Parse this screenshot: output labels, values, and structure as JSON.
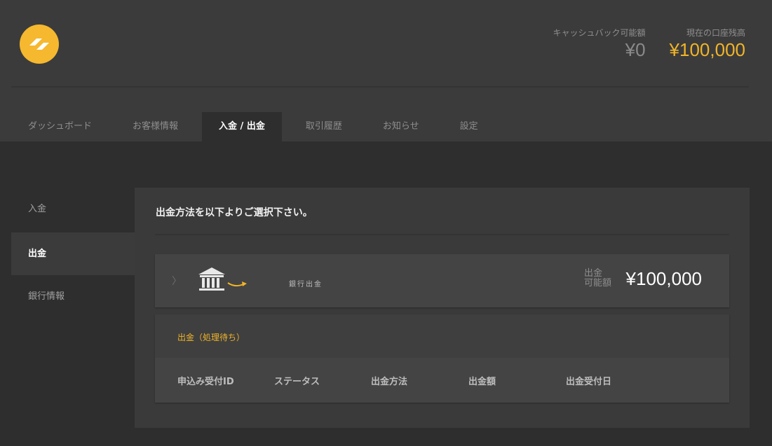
{
  "header": {
    "logo": "logo-icon",
    "cashback": {
      "label": "キャッシュバック可能額",
      "value": "¥0"
    },
    "balance": {
      "label": "現在の口座残高",
      "value": "¥100,000"
    }
  },
  "tabs": [
    {
      "label": "ダッシュボード"
    },
    {
      "label": "お客様情報"
    },
    {
      "label": "入金 / 出金"
    },
    {
      "label": "取引履歴"
    },
    {
      "label": "お知らせ"
    },
    {
      "label": "設定"
    }
  ],
  "sidebar": {
    "items": [
      {
        "label": "入金"
      },
      {
        "label": "出金"
      },
      {
        "label": "銀行情報"
      }
    ]
  },
  "panel": {
    "title": "出金方法を以下よりご選択下さい。",
    "method": {
      "label": "銀行出金",
      "icon": "bank-icon",
      "available_label_line1": "出金",
      "available_label_line2": "可能額",
      "available_value": "¥100,000"
    },
    "pending": {
      "title": "出金（処理待ち）",
      "columns": [
        "申込み受付ID",
        "ステータス",
        "出金方法",
        "出金額",
        "出金受付日"
      ]
    }
  },
  "colors": {
    "accent": "#f0b429",
    "background": "#2e2e2e",
    "header": "#3b3b3b"
  }
}
